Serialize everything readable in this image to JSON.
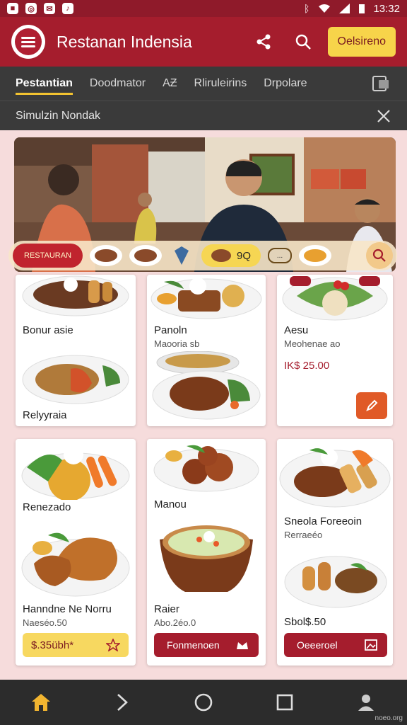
{
  "status_bar": {
    "time": "13:32",
    "icons": [
      "app-icon",
      "chrome-icon",
      "messenger-icon",
      "music-icon",
      "bluetooth-icon",
      "wifi-icon",
      "signal-icon",
      "battery-icon"
    ]
  },
  "app_bar": {
    "title": "Restanan Indensia",
    "action_button": "Oelsireno",
    "icons": [
      "share-icon",
      "search-icon"
    ]
  },
  "tabs": [
    {
      "label": "Pestantian",
      "active": true
    },
    {
      "label": "Doodmator",
      "active": false
    },
    {
      "label": "AƵ",
      "active": false
    },
    {
      "label": "Rliruleirins",
      "active": false
    },
    {
      "label": "Drpolare",
      "active": false
    }
  ],
  "subheader": {
    "text": "Simulzin Nondak"
  },
  "hero": {
    "promo_badge": "RESTAURAN",
    "chip_label": "9Q",
    "chip_outline_text": "..."
  },
  "menu_items": [
    {
      "title": "Bonur asie",
      "subtitle": ""
    },
    {
      "title": "Relyyraia",
      "subtitle": ""
    },
    {
      "title": "Panoln",
      "subtitle": "Maooria sb"
    },
    {
      "title": "Aesu",
      "subtitle": "Meohenae ao",
      "price": "IK$ 25.00"
    },
    {
      "title": "Renezado",
      "subtitle": ""
    },
    {
      "title": "Hanndne Ne Norru",
      "subtitle": "Naeséo.50",
      "price": "$.35übh*"
    },
    {
      "title": "Manou",
      "subtitle": ""
    },
    {
      "title": "Raier",
      "subtitle": "Abo.2éo.0",
      "button": "Fonmenoen"
    },
    {
      "title": "Sneola Foreeoin",
      "subtitle": "Rerraeéo"
    },
    {
      "title": "Sbol$.50",
      "subtitle": "",
      "button": "Oeeeroel"
    }
  ],
  "nav": [
    "home-icon",
    "back-icon",
    "circle-home-icon",
    "recents-icon",
    "profile-icon"
  ],
  "watermark": "noeo.org",
  "colors": {
    "primary": "#a51d2d",
    "accent": "#f7d44a",
    "tab_bg": "#3a3a3a",
    "orange": "#e05a27",
    "page_bg": "#f6dcdc"
  }
}
